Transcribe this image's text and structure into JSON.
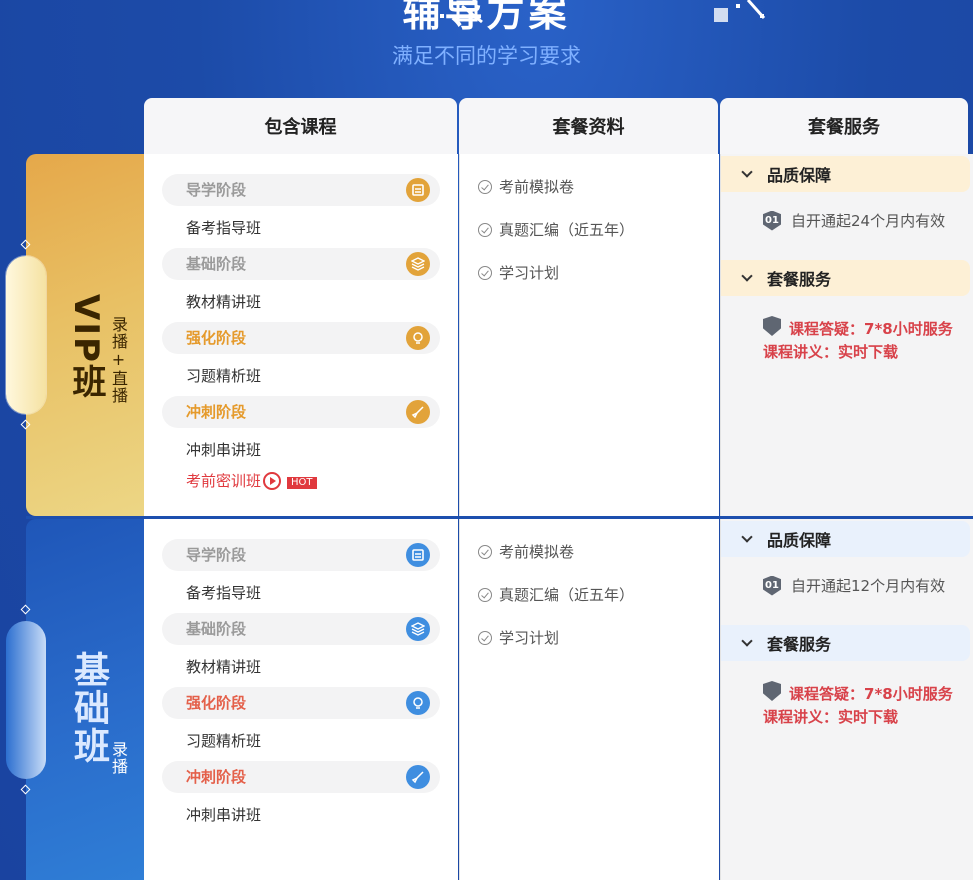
{
  "header": {
    "title": "辅导方案",
    "subtitle": "满足不同的学习要求"
  },
  "columns": [
    "包含课程",
    "套餐资料",
    "套餐服务"
  ],
  "vip": {
    "name": "VIP班",
    "mode": "录播+直播",
    "stages": [
      {
        "stage": "导学阶段",
        "course": "备考指导班",
        "icon": "book-icon"
      },
      {
        "stage": "基础阶段",
        "course": "教材精讲班",
        "icon": "layers-icon"
      },
      {
        "stage": "强化阶段",
        "course": "习题精析班",
        "icon": "lightbulb-icon"
      },
      {
        "stage": "冲刺阶段",
        "course": "冲刺串讲班",
        "icon": "rocket-icon"
      }
    ],
    "extra_course": "考前密训班",
    "hot": "HOT",
    "materials": [
      "考前模拟卷",
      "真题汇编（近五年）",
      "学习计划"
    ],
    "quality_head": "品质保障",
    "badge": "01",
    "validity": "自开通起24个月内有效",
    "service_head": "套餐服务",
    "service_lines": [
      "课程答疑：7*8小时服务",
      "课程讲义：实时下载"
    ]
  },
  "base": {
    "name": "基础班",
    "mode": "录播",
    "stages": [
      {
        "stage": "导学阶段",
        "course": "备考指导班",
        "icon": "book-icon"
      },
      {
        "stage": "基础阶段",
        "course": "教材精讲班",
        "icon": "layers-icon"
      },
      {
        "stage": "强化阶段",
        "course": "习题精析班",
        "icon": "lightbulb-icon"
      },
      {
        "stage": "冲刺阶段",
        "course": "冲刺串讲班",
        "icon": "rocket-icon"
      }
    ],
    "materials": [
      "考前模拟卷",
      "真题汇编（近五年）",
      "学习计划"
    ],
    "quality_head": "品质保障",
    "badge": "01",
    "validity": "自开通起12个月内有效",
    "service_head": "套餐服务",
    "service_lines": [
      "课程答疑：7*8小时服务",
      "课程讲义：实时下载"
    ]
  },
  "colors": {
    "background": "#1d4fae",
    "gold": "#e2a33a",
    "blue": "#3f8ee0",
    "red": "#d8424a"
  }
}
